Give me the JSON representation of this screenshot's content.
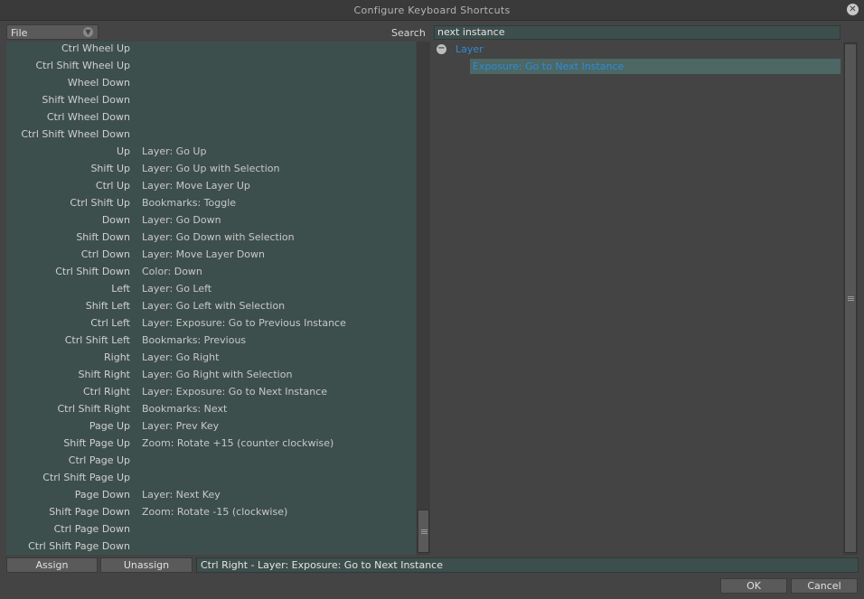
{
  "window": {
    "title": "Configure Keyboard Shortcuts"
  },
  "file_dropdown": {
    "selected": "File"
  },
  "search": {
    "label": "Search",
    "value": "next instance"
  },
  "shortcuts": [
    {
      "key": "Ctrl Wheel Up",
      "command": ""
    },
    {
      "key": "Ctrl Shift Wheel Up",
      "command": ""
    },
    {
      "key": "Wheel Down",
      "command": ""
    },
    {
      "key": "Shift Wheel Down",
      "command": ""
    },
    {
      "key": "Ctrl Wheel Down",
      "command": ""
    },
    {
      "key": "Ctrl Shift Wheel Down",
      "command": ""
    },
    {
      "key": "Up",
      "command": "Layer: Go Up"
    },
    {
      "key": "Shift Up",
      "command": "Layer: Go Up with Selection"
    },
    {
      "key": "Ctrl Up",
      "command": "Layer: Move Layer Up"
    },
    {
      "key": "Ctrl Shift Up",
      "command": "Bookmarks: Toggle"
    },
    {
      "key": "Down",
      "command": "Layer: Go Down"
    },
    {
      "key": "Shift Down",
      "command": "Layer: Go Down with Selection"
    },
    {
      "key": "Ctrl Down",
      "command": "Layer: Move Layer Down"
    },
    {
      "key": "Ctrl Shift Down",
      "command": "Color: Down"
    },
    {
      "key": "Left",
      "command": "Layer: Go Left"
    },
    {
      "key": "Shift Left",
      "command": "Layer: Go Left with Selection"
    },
    {
      "key": "Ctrl Left",
      "command": "Layer: Exposure: Go to Previous Instance"
    },
    {
      "key": "Ctrl Shift Left",
      "command": "Bookmarks: Previous"
    },
    {
      "key": "Right",
      "command": "Layer: Go Right"
    },
    {
      "key": "Shift Right",
      "command": "Layer: Go Right with Selection"
    },
    {
      "key": "Ctrl Right",
      "command": "Layer: Exposure: Go to Next Instance"
    },
    {
      "key": "Ctrl Shift Right",
      "command": "Bookmarks: Next"
    },
    {
      "key": "Page Up",
      "command": "Layer: Prev Key"
    },
    {
      "key": "Shift Page Up",
      "command": "Zoom: Rotate +15 (counter clockwise)"
    },
    {
      "key": "Ctrl Page Up",
      "command": ""
    },
    {
      "key": "Ctrl Shift Page Up",
      "command": ""
    },
    {
      "key": "Page Down",
      "command": "Layer: Next Key"
    },
    {
      "key": "Shift Page Down",
      "command": "Zoom: Rotate -15 (clockwise)"
    },
    {
      "key": "Ctrl Page Down",
      "command": ""
    },
    {
      "key": "Ctrl Shift Page Down",
      "command": ""
    }
  ],
  "tree": {
    "root": {
      "label": "Layer",
      "icon": "collapse-icon"
    },
    "child": {
      "label": "Exposure: Go to Next Instance"
    }
  },
  "buttons": {
    "assign": "Assign",
    "unassign": "Unassign",
    "ok": "OK",
    "cancel": "Cancel"
  },
  "status": {
    "value": "Ctrl Right - Layer: Exposure: Go to Next Instance"
  },
  "colors": {
    "background": "#444444",
    "list_background": "#3d4f4c",
    "highlight": "#4c6764",
    "tree_text": "#2e8bd8"
  }
}
